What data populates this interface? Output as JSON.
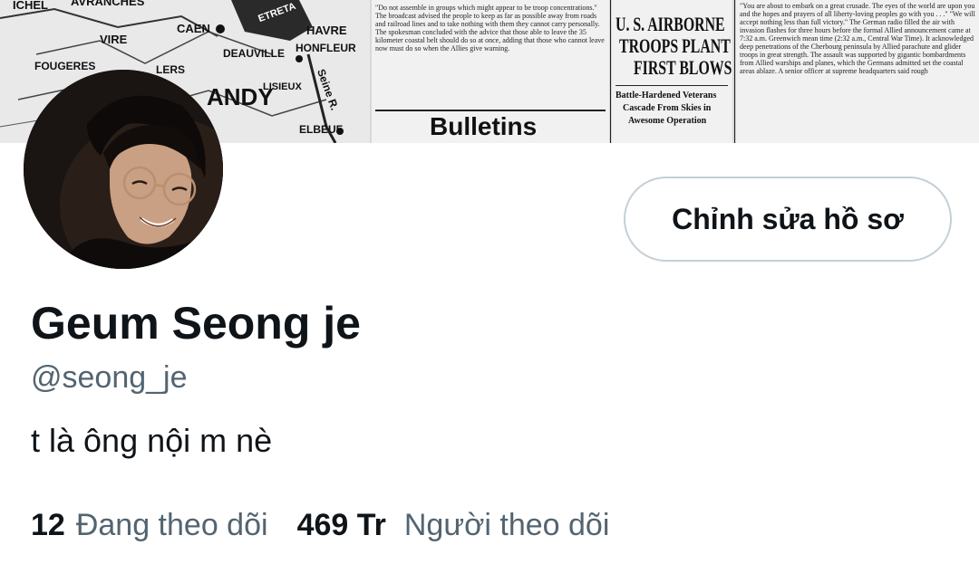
{
  "banner": {
    "map_labels": {
      "avranches": "AVRANCHES",
      "michel": "ICHEL",
      "vire": "VIRE",
      "caen": "CAEN",
      "havre": "HAVRE",
      "honfleur": "HONFLEUR",
      "deauville": "DEAUVILLE",
      "fougeres": "FOUGERES",
      "lisieux": "LISIEUX",
      "andy": "ANDY",
      "seine": "Seine R.",
      "elbeuf": "ELBEUF",
      "etreta": "ETRETA",
      "lers": "LERS"
    },
    "headline_1": "U. S. AIRBORNE",
    "headline_2": "TROOPS PLANT",
    "headline_3": "FIRST BLOWS",
    "subhead_1": "Battle-Hardened Veterans",
    "subhead_2": "Cascade From Skies in",
    "subhead_3": "Awesome Operation",
    "bulletins": "Bulletins",
    "col_text_1": "\"Do not assemble in groups which might appear to be troop concentrations.\" The broadcast advised the people to keep as far as possible away from roads and railroad lines and to take nothing with them they cannot carry personally. The spokesman concluded with the advice that those able to leave the 35 kilometer coastal belt should do so at once, adding that those who cannot leave now must do so when the Allies give warning.",
    "col_text_2": "\"You are about to embark on a great crusade. The eyes of the world are upon you and the hopes and prayers of all liberty-loving peoples go with you . . .\" \"We will accept nothing less than full victory.\" The German radio filled the air with invasion flashes for three hours before the formal Allied announcement came at 7:32 a.m. Greenwich mean time (2:32 a.m., Central War Time). It acknowledged deep penetrations of the Cherbourg peninsula by Allied parachute and glider troops in great strength. The assault was supported by gigantic bombardments from Allied warships and planes, which the Germans admitted set the coastal areas ablaze. A senior officer at supreme headquarters said rough"
  },
  "profile": {
    "edit_button": "Chỉnh sửa hồ sơ",
    "display_name": "Geum Seong je",
    "handle": "@seong_je",
    "bio": "t là ông nội m nè",
    "following_count": "12",
    "following_label": "Đang theo dõi",
    "followers_count": "469 Tr",
    "followers_label": "Người theo dõi"
  },
  "colors": {
    "text_primary": "#0f1419",
    "text_secondary": "#536471",
    "button_border": "#c4cfd6"
  }
}
